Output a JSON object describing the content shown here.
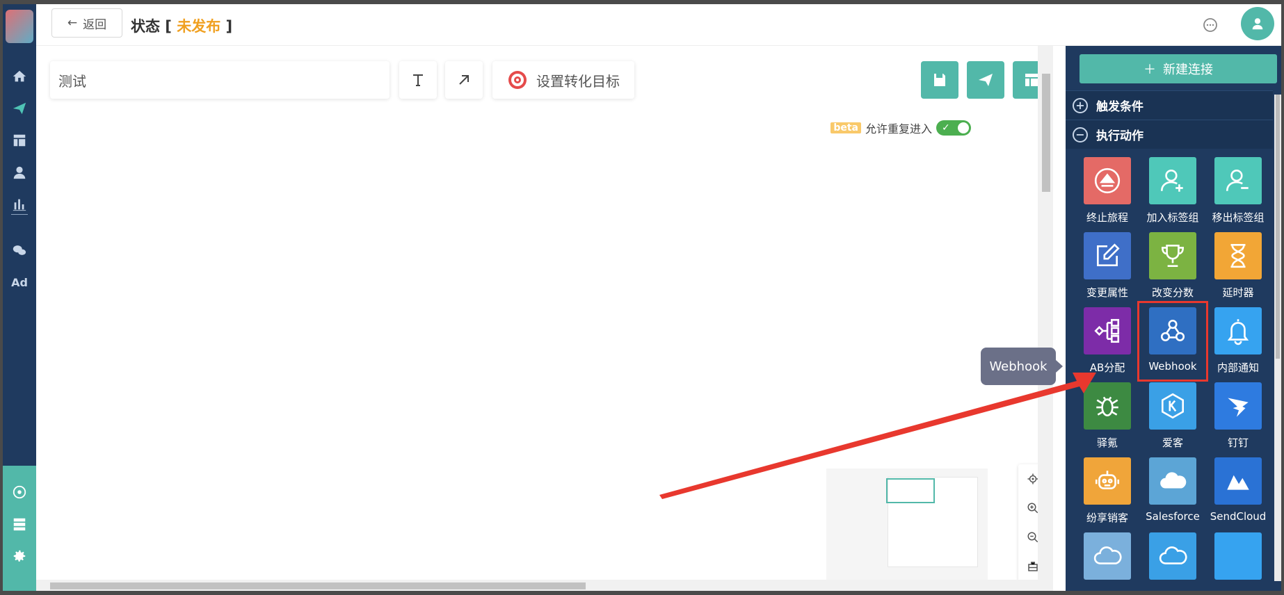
{
  "topbar": {
    "back_label": "返回",
    "status_prefix": "状态 [",
    "status_value": "未发布",
    "status_suffix": "]"
  },
  "canvas": {
    "name_value": "测试",
    "goal_label": "设置转化目标",
    "beta_badge": "beta",
    "reentry_label": "允许重复进入",
    "reentry_enabled": true
  },
  "right_panel": {
    "new_connection_label": "新建连接",
    "sections": [
      {
        "label": "触发条件",
        "expanded": false
      },
      {
        "label": "执行动作",
        "expanded": true
      }
    ],
    "tiles": [
      {
        "label": "终止旅程",
        "icon": "eject-icon",
        "color": "#e46a66"
      },
      {
        "label": "加入标签组",
        "icon": "user-plus-icon",
        "color": "#4fc8b9"
      },
      {
        "label": "移出标签组",
        "icon": "user-minus-icon",
        "color": "#4fc8b9"
      },
      {
        "label": "变更属性",
        "icon": "edit-icon",
        "color": "#3f6fc8"
      },
      {
        "label": "改变分数",
        "icon": "trophy-icon",
        "color": "#7cb342"
      },
      {
        "label": "延时器",
        "icon": "hourglass-icon",
        "color": "#f2a636"
      },
      {
        "label": "AB分配",
        "icon": "split-icon",
        "color": "#7d2ca8"
      },
      {
        "label": "Webhook",
        "icon": "webhook-icon",
        "color": "#2f6fc2"
      },
      {
        "label": "内部通知",
        "icon": "bell-icon",
        "color": "#36a3f0"
      },
      {
        "label": "驿氪",
        "icon": "bug-icon",
        "color": "#3d8a42"
      },
      {
        "label": "爱客",
        "icon": "k-icon",
        "color": "#3aa0e6"
      },
      {
        "label": "钉钉",
        "icon": "dingtalk-icon",
        "color": "#2e7be0"
      },
      {
        "label": "纷享销客",
        "icon": "robot-icon",
        "color": "#f0a53a"
      },
      {
        "label": "Salesforce",
        "icon": "cloud-icon",
        "color": "#5ca5d6"
      },
      {
        "label": "SendCloud",
        "icon": "sendcloud-icon",
        "color": "#2a72d5"
      }
    ],
    "tooltip": "Webhook"
  },
  "colors": {
    "primary": "#52b8a9",
    "nav_bg": "#1f3a5f",
    "status_accent": "#f0a020",
    "highlight": "#e8382e"
  }
}
